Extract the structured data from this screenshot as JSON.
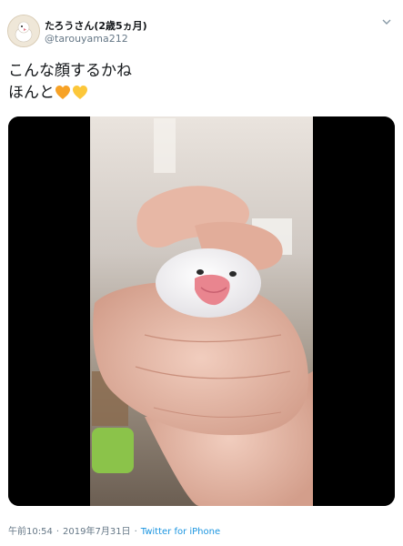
{
  "author": {
    "display_name": "たろうさん(2歳5ヵ月)",
    "handle": "@tarouyama212",
    "avatar_icon": "bird-avatar-icon"
  },
  "tweet": {
    "line1": "こんな顔するかね",
    "line2": "ほんと",
    "emojis": [
      "orange-heart-icon",
      "yellow-heart-icon"
    ],
    "heart_colors": [
      "#f7a226",
      "#fcc73a"
    ]
  },
  "media": {
    "type": "video",
    "content": "white-java-sparrow-in-hand"
  },
  "meta": {
    "time": "午前10:54",
    "separator": "·",
    "date": "2019年7月31日",
    "source": "Twitter for iPhone"
  },
  "colors": {
    "text": "#14171a",
    "secondary": "#657786",
    "link": "#1b95e0",
    "media_bg": "#000000"
  }
}
